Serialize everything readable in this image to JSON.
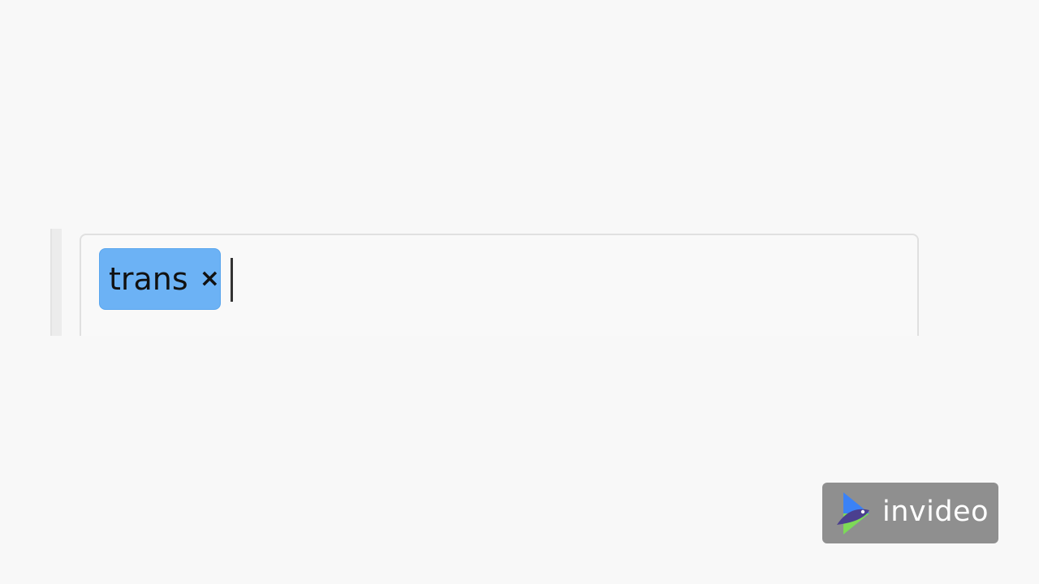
{
  "tag_input": {
    "tags": [
      {
        "label": "trans",
        "remove_label": "×"
      }
    ],
    "value": ""
  },
  "watermark": {
    "brand": "invideo",
    "icon": "invideo-logo-icon"
  },
  "colors": {
    "chip_background": "#6cb2f5",
    "input_border": "#e0e0e0",
    "watermark_background": "#8f8f8f"
  }
}
